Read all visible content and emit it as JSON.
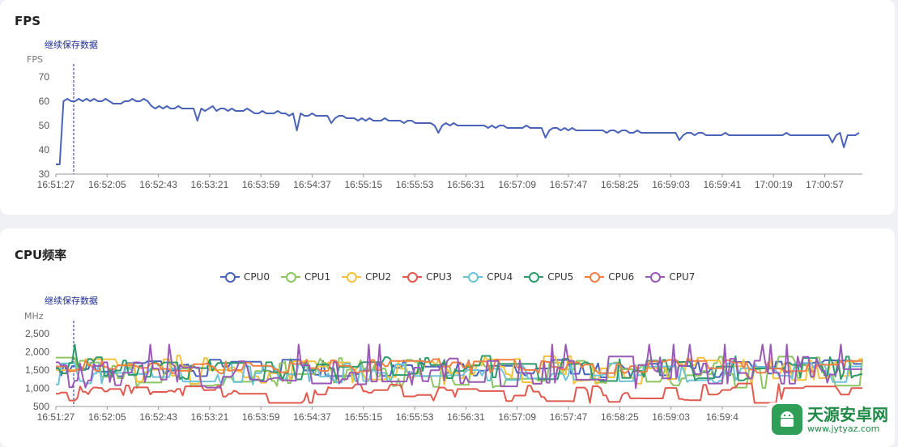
{
  "fps_panel": {
    "title": "FPS",
    "save_link": "继续保存数据",
    "unit": "FPS"
  },
  "cpu_panel": {
    "title": "CPU频率",
    "save_link": "继续保存数据",
    "unit": "MHz"
  },
  "watermark": {
    "name": "天源安卓网",
    "url": "www.jytyaz.com"
  },
  "chart_data": [
    {
      "type": "line",
      "title": "FPS",
      "ylabel": "FPS",
      "ylim": [
        30,
        70
      ],
      "yticks": [
        "30",
        "40",
        "50",
        "60",
        "70"
      ],
      "xticks": [
        "16:51:27",
        "16:52:05",
        "16:52:43",
        "16:53:21",
        "16:53:59",
        "16:54:37",
        "16:55:15",
        "16:55:53",
        "16:56:31",
        "16:57:09",
        "16:57:47",
        "16:58:25",
        "16:59:03",
        "16:59:41",
        "17:00:19",
        "17:00:57"
      ],
      "marker_time": "16:51:40",
      "series": [
        {
          "color": "#4a63b8",
          "values": [
            34,
            34,
            60,
            61,
            60,
            60,
            61,
            60,
            61,
            60,
            61,
            60,
            60,
            61,
            60,
            59,
            59,
            59,
            60,
            60,
            61,
            60,
            60,
            61,
            60,
            58,
            57,
            58,
            57,
            58,
            57,
            57,
            58,
            57,
            57,
            57,
            57,
            58,
            57,
            56,
            57,
            58,
            56,
            57,
            57,
            56,
            57,
            56,
            56,
            56,
            57,
            56,
            55,
            55,
            56,
            55,
            55,
            55,
            56,
            55,
            55,
            54,
            55,
            55,
            55,
            54,
            54,
            55,
            54,
            54,
            54,
            54,
            54,
            53,
            54,
            54,
            53,
            53,
            53,
            52,
            53,
            52,
            53,
            52,
            52,
            52,
            53,
            52,
            52,
            52,
            52,
            51,
            52,
            52,
            51,
            51,
            51,
            51,
            51,
            50,
            51,
            50,
            51,
            50,
            51,
            50,
            50,
            50,
            50,
            50,
            50,
            50,
            50,
            49,
            50,
            49,
            50,
            50,
            49,
            49,
            49,
            49,
            49,
            50,
            49,
            49,
            49,
            49,
            49,
            48,
            49,
            49,
            48,
            49,
            48,
            49,
            48,
            48,
            48,
            48,
            48,
            48,
            48,
            48,
            47,
            48,
            48,
            47,
            48,
            48,
            47,
            47,
            48,
            47,
            47,
            47,
            47,
            47,
            47,
            47,
            47,
            47,
            47,
            47,
            46,
            47,
            47,
            46,
            47,
            47,
            46,
            46,
            46,
            46,
            46,
            47,
            46,
            46,
            46,
            46,
            46,
            46,
            46,
            46,
            46,
            46,
            46,
            46,
            46,
            46,
            46,
            47,
            46,
            46,
            46,
            46,
            46,
            46,
            46,
            46,
            46,
            46,
            46,
            46,
            46,
            47,
            46,
            46,
            46,
            46,
            47
          ],
          "dips": [
            [
              37,
              52
            ],
            [
              63,
              48
            ],
            [
              72,
              51
            ],
            [
              100,
              47
            ],
            [
              128,
              45
            ],
            [
              163,
              44
            ],
            [
              188,
              46
            ],
            [
              203,
              43
            ],
            [
              206,
              41
            ],
            [
              219,
              46
            ],
            [
              224,
              47
            ],
            [
              229,
              45
            ],
            [
              236,
              44
            ],
            [
              261,
              45
            ],
            [
              268,
              40
            ]
          ]
        }
      ]
    },
    {
      "type": "line",
      "title": "CPU频率",
      "ylabel": "MHz",
      "ylim": [
        500,
        2500
      ],
      "yticks": [
        "500",
        "1,000",
        "1,500",
        "2,000",
        "2,500"
      ],
      "xticks": [
        "16:51:27",
        "16:52:05",
        "16:52:43",
        "16:53:21",
        "16:53:59",
        "16:54:37",
        "16:55:15",
        "16:55:53",
        "16:56:31",
        "16:57:09",
        "16:57:47",
        "16:58:25",
        "16:59:03",
        "16:59:4"
      ],
      "marker_time": "16:51:40",
      "series": [
        {
          "name": "CPU0",
          "color": "#4a63b8",
          "base": 1550,
          "amp": 250,
          "seed": 11
        },
        {
          "name": "CPU1",
          "color": "#8cc561",
          "base": 1450,
          "amp": 450,
          "seed": 23
        },
        {
          "name": "CPU2",
          "color": "#f4c13d",
          "base": 1500,
          "amp": 400,
          "seed": 37
        },
        {
          "name": "CPU3",
          "color": "#e05a4f",
          "base": 850,
          "amp": 300,
          "seed": 41
        },
        {
          "name": "CPU4",
          "color": "#6cc3d6",
          "base": 1400,
          "amp": 300,
          "seed": 53
        },
        {
          "name": "CPU5",
          "color": "#2f9a69",
          "base": 1550,
          "amp": 350,
          "seed": 67
        },
        {
          "name": "CPU6",
          "color": "#f07f45",
          "base": 1600,
          "amp": 200,
          "seed": 79
        },
        {
          "name": "CPU7",
          "color": "#9b59b6",
          "base": 1450,
          "amp": 450,
          "seed": 97
        }
      ],
      "legend": [
        "CPU0",
        "CPU1",
        "CPU2",
        "CPU3",
        "CPU4",
        "CPU5",
        "CPU6",
        "CPU7"
      ]
    }
  ]
}
